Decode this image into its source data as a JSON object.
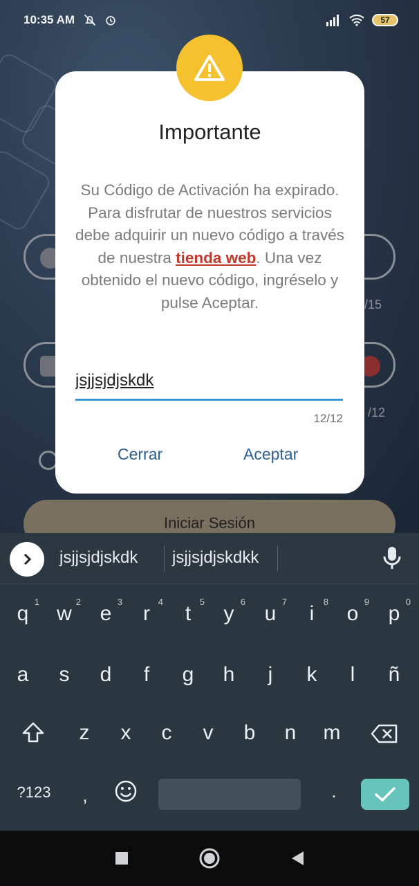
{
  "status_bar": {
    "time": "10:35 AM",
    "left_icons": [
      "bell-off-icon",
      "alarm-icon"
    ],
    "right_icons": [
      "signal-icon",
      "wifi-icon"
    ],
    "battery": "57"
  },
  "background_app": {
    "username_counter": "/15",
    "password_counter": "/12",
    "login_button": "Iniciar Sesión"
  },
  "dialog": {
    "icon": "warning-icon",
    "title": "Importante",
    "body_before_link": "Su Código de Activación ha expirado. Para disfrutar de nuestros servicios debe adquirir un nuevo código a través de nuestra ",
    "link_text": "tienda web",
    "body_after_link": ". Una vez obtenido el nuevo código, ingréselo y pulse Aceptar.",
    "input_value": "jsjjsjdjskdk",
    "char_counter": "12/12",
    "close_button": "Cerrar",
    "accept_button": "Aceptar"
  },
  "keyboard": {
    "suggestions": [
      "jsjjsjdjskdk",
      "jsjjsjdjskdkk"
    ],
    "row1": [
      "q",
      "w",
      "e",
      "r",
      "t",
      "y",
      "u",
      "i",
      "o",
      "p"
    ],
    "row1_digits": [
      "1",
      "2",
      "3",
      "4",
      "5",
      "6",
      "7",
      "8",
      "9",
      "0"
    ],
    "row2": [
      "a",
      "s",
      "d",
      "f",
      "g",
      "h",
      "j",
      "k",
      "l",
      "ñ"
    ],
    "row3": [
      "z",
      "x",
      "c",
      "v",
      "b",
      "n",
      "m"
    ],
    "symbols_key": "?123",
    "comma_key": ",",
    "period_key": "."
  },
  "accent_colors": {
    "warning": "#f5c12f",
    "link": "#c0392b",
    "input_underline": "#3a96d6",
    "button_text": "#2b5f8e",
    "enter_key": "#67c4bd"
  }
}
